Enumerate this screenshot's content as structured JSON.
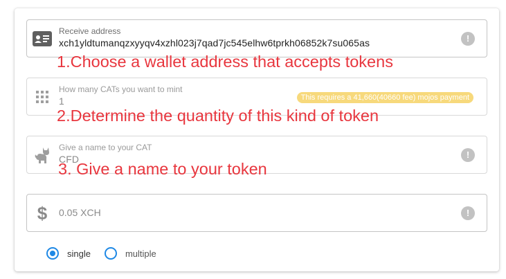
{
  "receive_address": {
    "label": "Receive address",
    "value": "xch1yldtumanqzxyyqv4xzhl023j7qad7jc545elhw6tprkh06852k7su065as",
    "icon": "id-card-icon",
    "help_icon": "!"
  },
  "mint_quantity": {
    "label": "How many CATs you want to mint",
    "value": "1",
    "icon": "keypad-icon",
    "badge": "This requires a 41,660(40660 fee) mojos payment"
  },
  "cat_name": {
    "label": "Give a name to your CAT",
    "value": "CFD",
    "icon": "cat-icon",
    "help_icon": "!"
  },
  "fee": {
    "value": "0.05 XCH",
    "icon": "dollar-icon",
    "help_icon": "!"
  },
  "mode": {
    "options": [
      "single",
      "multiple"
    ],
    "selected": "single"
  },
  "annotations": [
    "1.Choose a wallet address that accepts tokens",
    "2.Determine the quantity of this kind of token",
    "3. Give a name to your token"
  ],
  "colors": {
    "annotation": "#e8363e",
    "accent": "#1e88e5",
    "badge": "#f7d97c"
  }
}
